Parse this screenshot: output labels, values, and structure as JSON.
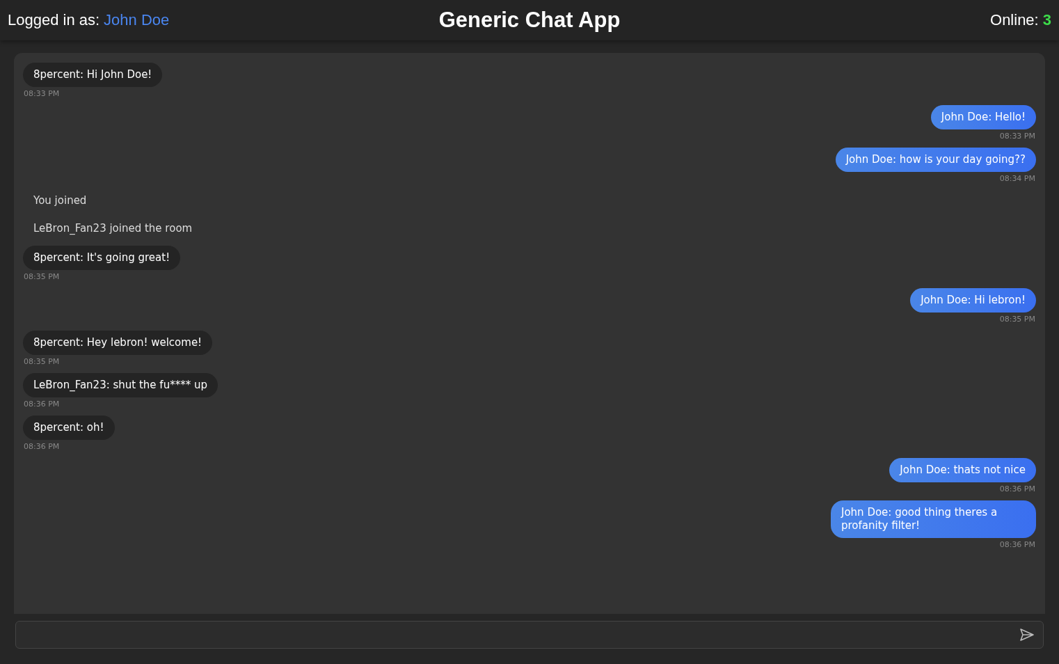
{
  "header": {
    "logged_in_label": "Logged in as:",
    "user_name": "John Doe",
    "title": "Generic Chat App",
    "online_label": "Online:",
    "online_count": "3"
  },
  "messages": [
    {
      "kind": "other",
      "text": "8percent: Hi John Doe!",
      "time": "08:33 PM"
    },
    {
      "kind": "self",
      "text": "John Doe: Hello!",
      "time": "08:33 PM"
    },
    {
      "kind": "self",
      "text": "John Doe: how is your day going??",
      "time": "08:34 PM"
    },
    {
      "kind": "system",
      "text": "You joined"
    },
    {
      "kind": "system",
      "text": "LeBron_Fan23 joined the room"
    },
    {
      "kind": "other",
      "text": "8percent: It's going great!",
      "time": "08:35 PM"
    },
    {
      "kind": "self",
      "text": "John Doe: Hi lebron!",
      "time": "08:35 PM"
    },
    {
      "kind": "other",
      "text": "8percent: Hey lebron! welcome!",
      "time": "08:35 PM"
    },
    {
      "kind": "other",
      "text": "LeBron_Fan23: shut the fu**** up",
      "time": "08:36 PM"
    },
    {
      "kind": "other",
      "text": "8percent: oh!",
      "time": "08:36 PM"
    },
    {
      "kind": "self",
      "text": "John Doe: thats not nice",
      "time": "08:36 PM"
    },
    {
      "kind": "self",
      "text": "John Doe: good thing theres a profanity filter!",
      "time": "08:36 PM"
    }
  ]
}
